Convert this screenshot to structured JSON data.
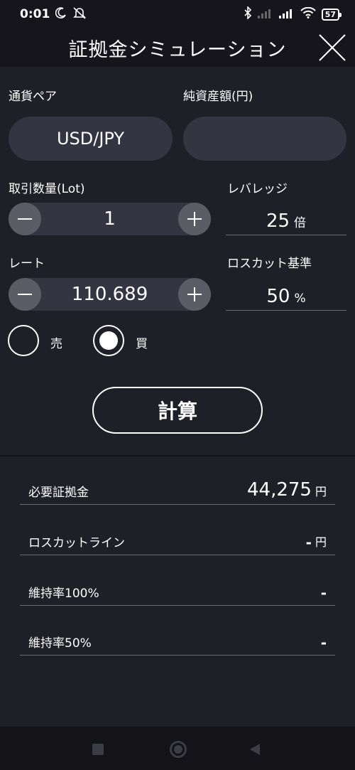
{
  "status_bar": {
    "time": "0:01",
    "battery": "57",
    "icons": [
      "moon-icon",
      "mute-icon",
      "bluetooth-icon",
      "signal-icon",
      "signal-icon",
      "wifi-icon",
      "battery-icon"
    ]
  },
  "header": {
    "title": "証拠金シミュレーション",
    "close_icon": "close-icon"
  },
  "form": {
    "currency_pair_label": "通貨ペア",
    "currency_pair_value": "USD/JPY",
    "net_assets_label": "純資産額(円)",
    "net_assets_value": "",
    "quantity_label": "取引数量(Lot)",
    "quantity_value": "1",
    "leverage_label": "レバレッジ",
    "leverage_value": "25",
    "leverage_unit": "倍",
    "rate_label": "レート",
    "rate_value": "110.689",
    "losscut_label": "ロスカット基準",
    "losscut_value": "50",
    "losscut_unit": "%",
    "sell_label": "売",
    "buy_label": "買",
    "selected_side": "buy"
  },
  "calculate_button": "計算",
  "results": [
    {
      "label": "必要証拠金",
      "value": "44,275",
      "unit": "円"
    },
    {
      "label": "ロスカットライン",
      "value": "-",
      "unit": "円"
    },
    {
      "label": "維持率100%",
      "value": "-",
      "unit": ""
    },
    {
      "label": "維持率50%",
      "value": "-",
      "unit": ""
    }
  ],
  "colors": {
    "background": "#1f1f28",
    "header_bg": "#15151b",
    "field_bg": "#343443",
    "stepper_button": "#5c5c66"
  }
}
